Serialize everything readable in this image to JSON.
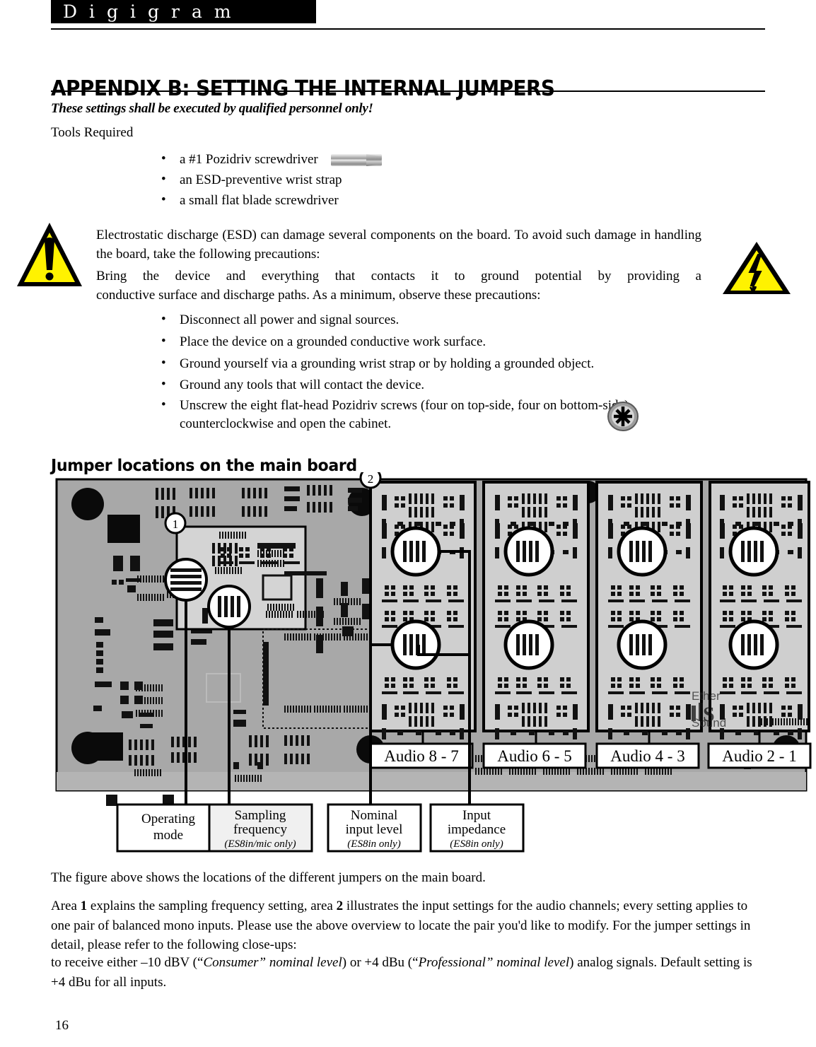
{
  "header": {
    "brand": "Digigram"
  },
  "title": "APPENDIX B: SETTING THE INTERNAL JUMPERS",
  "intro": {
    "warning_italic": "These settings shall be executed by qualified personnel only!",
    "tools_required_label": "Tools Required",
    "tools": [
      "a #1 Pozidriv screwdriver",
      "an ESD-preventive wrist strap",
      "a small flat blade screwdriver"
    ]
  },
  "esd": {
    "paragraph_1": "Electrostatic discharge (ESD) can damage several components on the board. To avoid such damage in handling the board, take the following precautions:",
    "paragraph_2_line_1": "Bring the device and everything that contacts it to ground potential by providing a",
    "paragraph_2_line_2": "conductive surface and discharge paths. As a minimum, observe these precautions:",
    "precautions": [
      "Disconnect all power and signal sources.",
      "Place the device on a grounded conductive work surface.",
      "Ground yourself via a grounding wrist strap or by holding a grounded object.",
      "Ground any tools that will contact the device.",
      "Unscrew the eight flat-head Pozidriv screws (four on top-side, four on bottom-side) counterclockwise and open the cabinet."
    ]
  },
  "section_heading": "Jumper locations on the main board",
  "figure": {
    "callout_markers": [
      "1",
      "2"
    ],
    "daughter_cards": [
      {
        "label": "Audio 8 - 7"
      },
      {
        "label": "Audio 6 - 5"
      },
      {
        "label": "Audio 4 - 3"
      },
      {
        "label": "Audio 2 - 1"
      }
    ],
    "watermark": {
      "line_1": "Ether",
      "line_2": "Sound"
    },
    "callout_boxes": [
      {
        "line_1": "Operating",
        "line_2": "mode",
        "line_3": ""
      },
      {
        "line_1": "Sampling",
        "line_2": "frequency",
        "line_3": "(ES8in/mic only)"
      },
      {
        "line_1": "Nominal",
        "line_2": "input level",
        "line_3": "(ES8in only)"
      },
      {
        "line_1": "Input",
        "line_2": "impedance",
        "line_3": "(ES8in only)"
      }
    ]
  },
  "body": {
    "paragraph_figure": "The figure above shows the locations of the different jumpers on the main board.",
    "paragraph_areas_pre": "Area ",
    "paragraph_areas_area1": "1",
    "paragraph_areas_mid": " explains the sampling frequency setting, area ",
    "paragraph_areas_area2": "2",
    "paragraph_areas_post": " illustrates the input settings for the audio channels; every setting applies to one pair of balanced mono inputs. Please use the above overview to locate the pair you'd like to modify. For the jumper settings in detail, please refer to the following close-ups:",
    "paragraph_levels_pre": "to receive either –10 dBV (“",
    "paragraph_levels_it1": "Consumer” nominal level",
    "paragraph_levels_mid": ") or +4 dBu (“",
    "paragraph_levels_it2": "Professional” nominal level",
    "paragraph_levels_post": ") analog signals. Default setting is +4 dBu for all inputs."
  },
  "page_number": "16",
  "colors": {
    "warning_yellow": "#FFF200",
    "pcb_gray": "#A8A8A8",
    "card_gray": "#CFCFCF",
    "black": "#000000"
  }
}
